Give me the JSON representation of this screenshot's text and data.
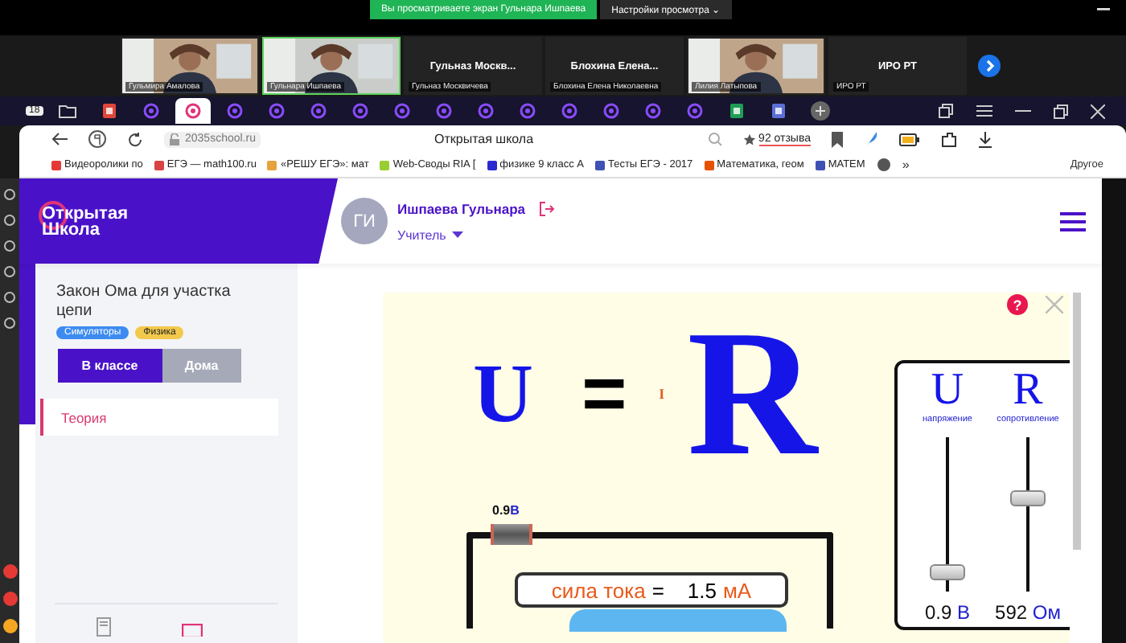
{
  "share_bar": {
    "notice": "Вы просматриваете экран Гульнара Ишпаева",
    "view_settings": "Настройки просмотра",
    "caret": "⌄"
  },
  "participants": [
    {
      "kind": "video",
      "label": "Гульмира Амалова",
      "speaking": false
    },
    {
      "kind": "video",
      "label": "Гульнара Ишпаева",
      "speaking": true
    },
    {
      "kind": "name",
      "display": "Гульназ Москв...",
      "label": "Гульназ Москвичева",
      "speaking": false
    },
    {
      "kind": "name",
      "display": "Блохина Елена...",
      "label": "Блохина Елена Николаевна",
      "speaking": false
    },
    {
      "kind": "video",
      "label": "Лилия Латыпова",
      "speaking": false
    },
    {
      "kind": "name",
      "display": "ИРО РТ",
      "label": "ИРО РТ",
      "speaking": false
    }
  ],
  "browser": {
    "tab_count": "18",
    "tabs": [
      {
        "kind": "pdf",
        "selected": false
      },
      {
        "kind": "site",
        "selected": false
      },
      {
        "kind": "site",
        "selected": true
      },
      {
        "kind": "site",
        "selected": false
      },
      {
        "kind": "site",
        "selected": false
      },
      {
        "kind": "site",
        "selected": false
      },
      {
        "kind": "site",
        "selected": false
      },
      {
        "kind": "site",
        "selected": false
      },
      {
        "kind": "site",
        "selected": false
      },
      {
        "kind": "site",
        "selected": false
      },
      {
        "kind": "site",
        "selected": false
      },
      {
        "kind": "site",
        "selected": false
      },
      {
        "kind": "site",
        "selected": false
      },
      {
        "kind": "site",
        "selected": false
      },
      {
        "kind": "site",
        "selected": false
      },
      {
        "kind": "sheet",
        "selected": false
      },
      {
        "kind": "doc",
        "selected": false
      }
    ],
    "url": "2035school.ru",
    "title": "Открытая школа",
    "reviews": "92 отзыва",
    "bookmarks": [
      {
        "label": "Видеоролики по",
        "color": "#e53935"
      },
      {
        "label": "ЕГЭ — math100.ru",
        "color": "#d84343"
      },
      {
        "label": "«РЕШУ ЕГЭ»: мат",
        "color": "#e6a23c"
      },
      {
        "label": "Web-Своды RIA [",
        "color": "#9acd32"
      },
      {
        "label": "физике 9 класс А",
        "color": "#2a2ad0"
      },
      {
        "label": "Тесты ЕГЭ - 2017",
        "color": "#3f51b5"
      },
      {
        "label": "Математика, геом",
        "color": "#e65100"
      },
      {
        "label": "МАТЕМ",
        "color": "#3f51b5"
      }
    ],
    "more": "»",
    "other": "Другое"
  },
  "site": {
    "logo_top": "Открытая",
    "logo_bottom": "Школа",
    "avatar": "ГИ",
    "user": "Ишпаева Гульнара",
    "role": "Учитель",
    "lesson_title": "Закон Ома для участка цепи",
    "tags": [
      {
        "label": "Симуляторы",
        "color": "#3d8bf0"
      },
      {
        "label": "Физика",
        "color": "#f2c94c"
      }
    ],
    "modes": [
      {
        "label": "В классе",
        "selected": true
      },
      {
        "label": "Дома",
        "selected": false
      }
    ],
    "sections": [
      {
        "label": "Теория",
        "selected": true
      }
    ]
  },
  "simulator": {
    "help": "?",
    "formula": {
      "u": "U",
      "eq": "=",
      "i": "I",
      "r": "R"
    },
    "sliders": [
      {
        "symbol": "U",
        "caption": "напряжение",
        "level": 0.08,
        "value": "0.9",
        "unit": "В"
      },
      {
        "symbol": "R",
        "caption": "сопротивление",
        "level": 0.6,
        "value": "592",
        "unit": "Ом"
      }
    ],
    "battery_label": {
      "value": "0.9",
      "unit": "В"
    },
    "readout": {
      "label": "сила тока",
      "eq": "=",
      "value": "1.5",
      "unit": "мА"
    }
  }
}
